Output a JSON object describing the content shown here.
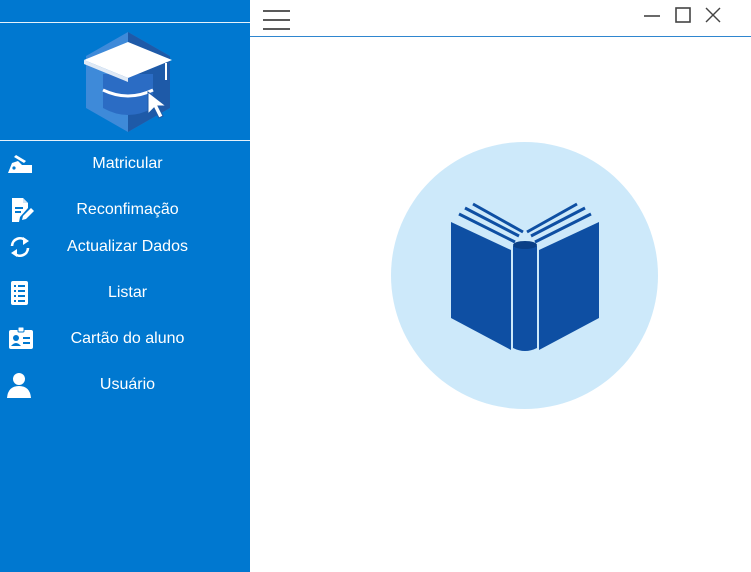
{
  "sidebar": {
    "logo_icon": "graduation-cap-cursor-hexagon-icon",
    "items": [
      {
        "label": "Matricular",
        "icon": "hand-writing-icon"
      },
      {
        "label": "Reconfimação",
        "icon": "document-edit-icon"
      },
      {
        "label": "Actualizar Dados",
        "icon": "refresh-icon"
      },
      {
        "label": "Listar",
        "icon": "list-document-icon"
      },
      {
        "label": "Cartão do aluno",
        "icon": "id-card-icon"
      },
      {
        "label": "Usuário",
        "icon": "user-icon"
      }
    ]
  },
  "titlebar": {
    "menu_icon": "hamburger-menu-icon",
    "controls": [
      "minimize-icon",
      "maximize-icon",
      "close-icon"
    ]
  },
  "main": {
    "hero_icon": "open-book-icon"
  },
  "colors": {
    "sidebar_bg": "#0078d0",
    "accent_line": "#2f86cf",
    "hero_circle": "#cde9fa",
    "book_blue": "#0e4fa3",
    "logo_dark": "#1e5aa8",
    "logo_light": "#3e8ad9"
  }
}
